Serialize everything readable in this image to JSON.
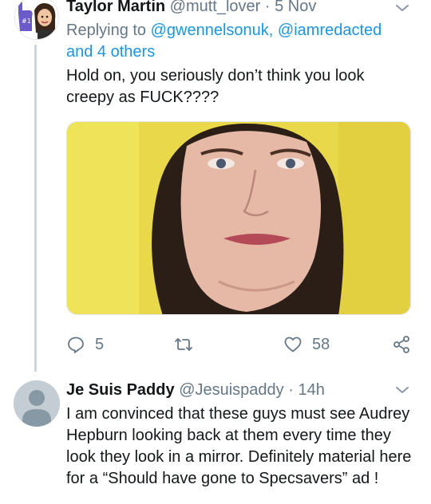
{
  "tweet1": {
    "name": "Taylor Martin",
    "handle": "@mutt_lover",
    "separator": "·",
    "time": "5 Nov",
    "replying_prefix": "Replying to",
    "replying_users": "@gwennelsonuk, @iamredacted",
    "replying_others": "and 4 others",
    "text": "Hold on, you seriously don’t think you look creepy as FUCK????",
    "actions": {
      "reply_count": "5",
      "retweet_count": "",
      "like_count": "58"
    }
  },
  "tweet2": {
    "name": "Je Suis Paddy",
    "handle": "@Jesuispaddy",
    "separator": "·",
    "time": "14h",
    "text": "I am convinced that these guys must see Audrey Hepburn looking back at them every time they look they look in a mirror. Definitely material here for a “Should have gone to Specsavers” ad !"
  },
  "colors": {
    "link": "#1b95e0",
    "muted": "#657786",
    "thread_line": "#ccd6dd",
    "image_background": "#e8d84a"
  }
}
